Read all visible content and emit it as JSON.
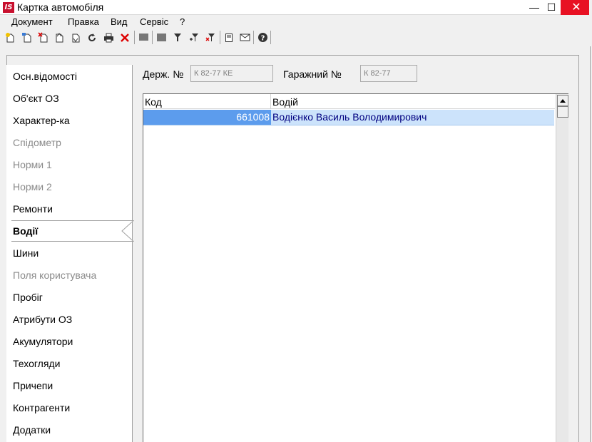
{
  "window": {
    "title": "Картка автомобіля",
    "logo_text": "IS",
    "minimize_glyph": "—",
    "maximize_glyph": "☐",
    "close_glyph": "✕"
  },
  "menu": [
    {
      "label": "Документ"
    },
    {
      "label": "Правка"
    },
    {
      "label": "Вид"
    },
    {
      "label": "Сервіс"
    },
    {
      "label": "?"
    }
  ],
  "toolbar": [
    {
      "icon": "new-doc-icon"
    },
    {
      "icon": "copy-doc-icon"
    },
    {
      "icon": "delete-doc-icon"
    },
    {
      "icon": "doc-up-icon"
    },
    {
      "icon": "doc-down-icon"
    },
    {
      "icon": "refresh-icon"
    },
    {
      "icon": "print-icon"
    },
    {
      "icon": "delete-icon"
    },
    {
      "icon": "view-gray-icon"
    },
    {
      "icon": "view-gray2-icon"
    },
    {
      "icon": "filter-icon"
    },
    {
      "icon": "filter-add-icon"
    },
    {
      "icon": "filter-remove-icon"
    },
    {
      "icon": "document-icon"
    },
    {
      "icon": "mail-icon"
    },
    {
      "icon": "help-icon"
    }
  ],
  "sidebar": {
    "items": [
      {
        "label": "Осн.відомості",
        "state": "normal"
      },
      {
        "label": "Об'єкт ОЗ",
        "state": "normal"
      },
      {
        "label": "Характер-ка",
        "state": "normal"
      },
      {
        "label": "Спідометр",
        "state": "disabled"
      },
      {
        "label": "Норми 1",
        "state": "disabled"
      },
      {
        "label": "Норми 2",
        "state": "disabled"
      },
      {
        "label": "Ремонти",
        "state": "normal"
      },
      {
        "label": "Водії",
        "state": "active"
      },
      {
        "label": "Шини",
        "state": "normal"
      },
      {
        "label": "Поля користувача",
        "state": "disabled"
      },
      {
        "label": "Пробіг",
        "state": "normal"
      },
      {
        "label": "Атрибути ОЗ",
        "state": "normal"
      },
      {
        "label": "Акумулятори",
        "state": "normal"
      },
      {
        "label": "Техогляди",
        "state": "normal"
      },
      {
        "label": "Причепи",
        "state": "normal"
      },
      {
        "label": "Контрагенти",
        "state": "normal"
      },
      {
        "label": "Додатки",
        "state": "normal"
      }
    ]
  },
  "fields": {
    "state_number_label": "Держ. №",
    "state_number_value": "К 82-77 КЕ",
    "garage_number_label": "Гаражний №",
    "garage_number_value": "К 82-77"
  },
  "grid": {
    "columns": [
      "Код",
      "Водій"
    ],
    "rows": [
      {
        "code": "661008",
        "driver": "Водієнко Василь Володимирович"
      }
    ]
  },
  "colors": {
    "selection": "#5c9ced",
    "row_highlight": "#cce3fb",
    "close_button": "#e81123",
    "logo": "#c8102e"
  }
}
